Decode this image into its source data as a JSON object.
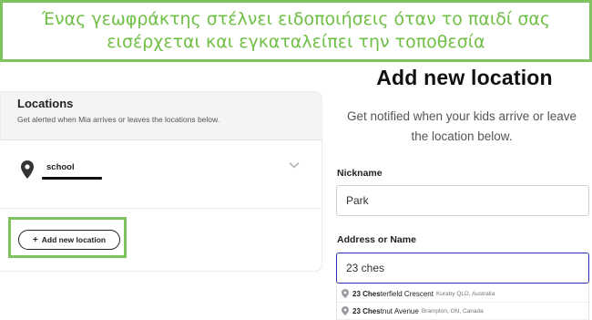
{
  "banner": {
    "text_line1": "Ένας γεωφράκτης στέλνει ειδοποιήσεις όταν το παιδί σας",
    "text_line2": "εισέρχεται και εγκαταλείπει την τοποθεσία",
    "color": "#6fbf45",
    "border_color": "#7ec35f"
  },
  "locations_panel": {
    "title": "Locations",
    "subtitle": "Get alerted when Mia arrives or leaves the locations below.",
    "items": [
      {
        "name": "school",
        "icon": "map-pin-icon"
      }
    ],
    "add_button_label": "Add new location",
    "add_button_icon": "+"
  },
  "form": {
    "title": "Add new location",
    "subtitle_line1": "Get notified when your kids arrive or leave",
    "subtitle_line2": "the location below.",
    "nickname_label": "Nickname",
    "nickname_value": "Park",
    "address_label": "Address or Name",
    "address_value": "23 ches",
    "suggestions": [
      {
        "bold": "23 Ches",
        "rest": "terfield Crescent",
        "sub": "Kuraby QLD, Australia"
      },
      {
        "bold": "23 Ches",
        "rest": "tnut Avenue",
        "sub": "Brampton, ON, Canada"
      }
    ]
  }
}
